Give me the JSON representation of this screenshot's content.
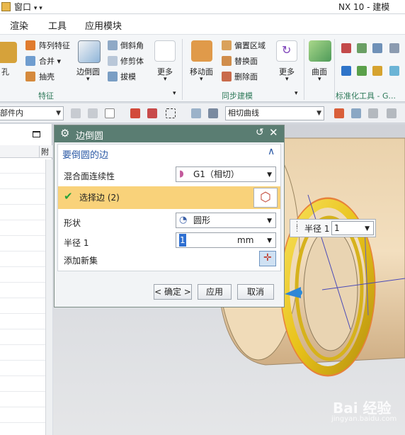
{
  "titlebar": {
    "window_menu": "窗口",
    "app_title": "NX 10 - 建模"
  },
  "tabs": [
    "渲染",
    "工具",
    "应用模块"
  ],
  "ribbon": {
    "feature_group": {
      "hole": "孔",
      "pattern_feature": "阵列特征",
      "combine": "合并",
      "shell": "抽壳",
      "edge_blend": "边倒圆",
      "chamfer": "倒斜角",
      "trim_body": "修剪体",
      "draft": "拔模",
      "more": "更多",
      "group_label": "特征"
    },
    "sync_group": {
      "move_face": "移动面",
      "offset_region": "偏置区域",
      "replace_face": "替换面",
      "delete_face": "删除面",
      "more": "更多",
      "group_label": "同步建模"
    },
    "surface_group": {
      "surface": "曲面"
    },
    "std_tools": {
      "group_label": "标准化工具 - G..."
    }
  },
  "selbar": {
    "filter_value": "部件内",
    "curve_rule": "相切曲线"
  },
  "dialog": {
    "title": "边倒圆",
    "section_title": "要倒圆的边",
    "blend_continuity_label": "混合面连续性",
    "blend_continuity_value": "G1（相切）",
    "select_edge_label": "选择边 (2)",
    "shape_label": "形状",
    "shape_value": "圆形",
    "radius_label": "半径 1",
    "radius_value": "1",
    "radius_unit": "mm",
    "add_new_set_label": "添加新集",
    "ok_button": "< 确定 >",
    "apply_button": "应用",
    "cancel_button": "取消"
  },
  "radius_tip": {
    "label": "半径 1",
    "value": "1"
  },
  "navpanel": {
    "column_header": "附"
  },
  "watermark": {
    "brand": "Bai 经验",
    "url": "jingyan.baidu.com"
  },
  "colors": {
    "dialog_title_bg": "#5a7d72",
    "selected_row_bg": "#f9d27a",
    "group_label": "#2f7a5a",
    "part_body": "#e6c89c",
    "blend_ring": "#f0c81e"
  }
}
